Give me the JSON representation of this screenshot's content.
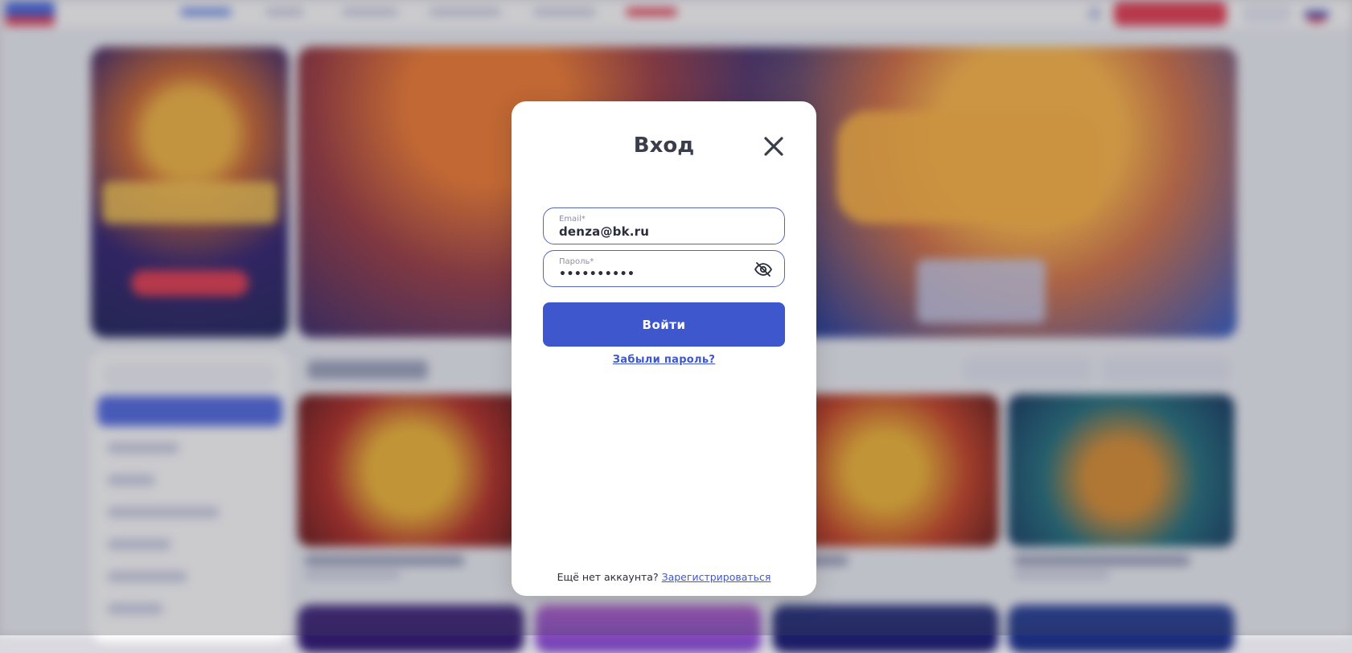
{
  "login_modal": {
    "title": "Вход",
    "email": {
      "label": "Email*",
      "value": "denza@bk.ru"
    },
    "password": {
      "label": "Пароль*",
      "value": "••••••••••"
    },
    "submit_label": "Войти",
    "forgot_label": "Забыли пароль?",
    "footer_text": "Ещё нет аккаунта?",
    "register_label": "Зарегистрироваться"
  },
  "icons": {
    "close": "close-icon",
    "eye_off": "eye-off-icon"
  },
  "colors": {
    "accent": "#3f57cd",
    "text": "#3a3d4a",
    "brand_red": "#e2344a"
  }
}
